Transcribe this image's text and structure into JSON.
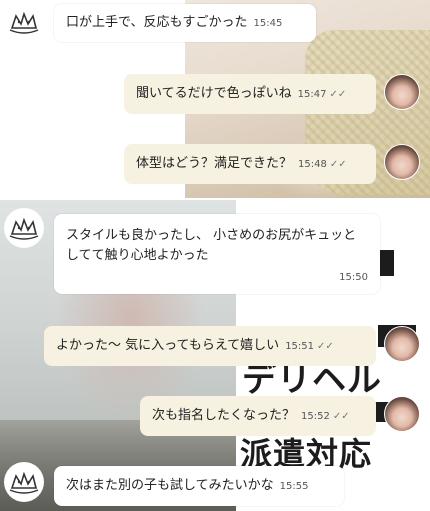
{
  "messages": [
    {
      "id": "m1",
      "direction": "incoming",
      "text": "口が上手で、反応もすごかった",
      "time": "15:45"
    },
    {
      "id": "m2",
      "direction": "outgoing",
      "text": "聞いてるだけで色っぽいね",
      "time": "15:47",
      "read_icon": "double-check-icon"
    },
    {
      "id": "m3",
      "direction": "outgoing",
      "text": "体型はどう？満足できた？",
      "time": "15:48",
      "read_icon": "double-check-icon"
    },
    {
      "id": "m4",
      "direction": "incoming",
      "text": "スタイルも良かったし、 小さめのお尻がキュッとしてて触り心地よかった",
      "time": "15:50"
    },
    {
      "id": "m5",
      "direction": "outgoing",
      "text": "よかった～ 気に入ってもらえて嬉しい",
      "time": "15:51",
      "read_icon": "double-check-icon"
    },
    {
      "id": "m6",
      "direction": "outgoing",
      "text": "次も指名したくなった？",
      "time": "15:52",
      "read_icon": "double-check-icon"
    },
    {
      "id": "m7",
      "direction": "incoming",
      "text": "次はまた別の子も試してみたいかな",
      "time": "15:55"
    }
  ],
  "background_ad": {
    "line1": "デリヘル",
    "line2": "派遣対応"
  },
  "avatars": {
    "incoming": "doodle-logo-avatar",
    "outgoing": "profile-photo-avatar"
  },
  "colors": {
    "incoming_bubble": "#ffffff",
    "outgoing_bubble": "#f6f1e0",
    "text": "#222222"
  }
}
